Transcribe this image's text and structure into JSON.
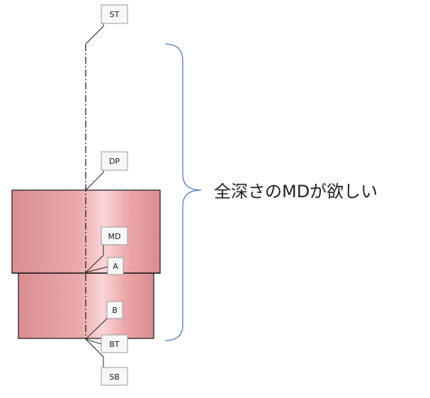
{
  "markers": {
    "st": "ST",
    "dp": "DP",
    "md": "MD",
    "a": "A",
    "b": "B",
    "bt": "BT",
    "sb": "SB"
  },
  "annotation": "全深さのMDが欲しい",
  "colors": {
    "pipe_fill": "#e9a4a6",
    "pipe_highlight": "#fbd6d8",
    "brace": "#4f7bc0",
    "outline": "#222222"
  }
}
